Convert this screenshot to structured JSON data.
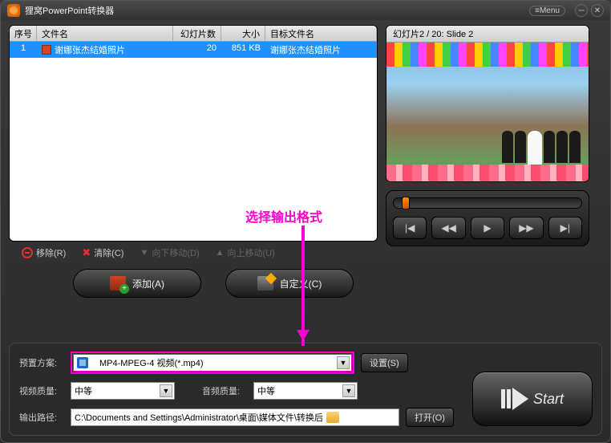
{
  "title": "狸窝PowerPoint转换器",
  "menu_label": "≡Menu",
  "columns": {
    "num": "序号",
    "name": "文件名",
    "slides": "幻灯片数",
    "size": "大小",
    "out": "目标文件名"
  },
  "row1": {
    "num": "1",
    "name": "谢娜张杰结婚照片",
    "slides": "20",
    "size": "851 KB",
    "out": "谢娜张杰结婚照片"
  },
  "preview_title": "幻灯片2 / 20: Slide 2",
  "actions": {
    "remove": "移除(R)",
    "clear": "清除(C)",
    "movedown": "向下移动(D)",
    "moveup": "向上移动(U)"
  },
  "big": {
    "add": "添加(A)",
    "custom": "自定义(C)"
  },
  "annotation": "选择输出格式",
  "labels": {
    "preset": "预置方案:",
    "vq": "视频质量:",
    "aq": "音频质量:",
    "output": "输出路径:"
  },
  "preset_value": "MP4-MPEG-4 视频(*.mp4)",
  "vq_value": "中等",
  "aq_value": "中等",
  "output_path": "C:\\Documents and Settings\\Administrator\\桌面\\媒体文件\\转换后",
  "buttons": {
    "settings": "设置(S)",
    "open": "打开(O)",
    "start": "Start"
  },
  "ctrl": {
    "first": "|◀",
    "prev": "◀◀",
    "play": "▶",
    "next": "▶▶",
    "last": "▶|"
  }
}
